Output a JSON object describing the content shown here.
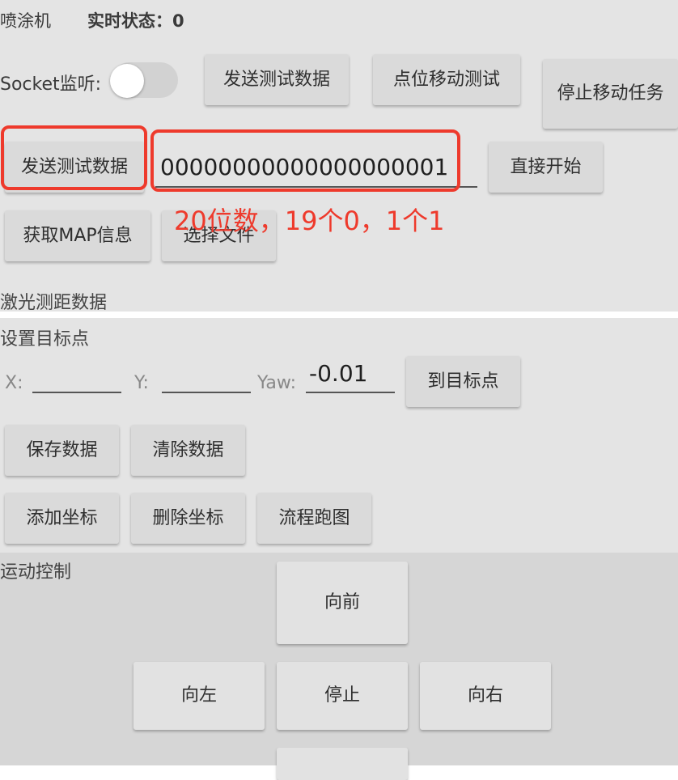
{
  "header": {
    "app_title": "喷涂机",
    "status_text": "实时状态：0"
  },
  "socket": {
    "label": "Socket监听:",
    "toggle_on": false
  },
  "row1": {
    "send_test": "发送测试数据",
    "point_move_test": "点位移动测试",
    "stop_move_task": "停止移动任务"
  },
  "row2": {
    "send_test": "发送测试数据",
    "data_value": "00000000000000000001",
    "direct_start": "直接开始"
  },
  "annotation": {
    "text": "20位数，19个0，1个1",
    "color": "#ee3a2c"
  },
  "row3": {
    "get_map": "获取MAP信息",
    "choose_file": "选择文件"
  },
  "laser_section": "激光测距数据",
  "target": {
    "section_title": "设置目标点",
    "x_label": "X:",
    "x_value": "",
    "y_label": "Y:",
    "y_value": "",
    "yaw_label": "Yaw:",
    "yaw_value": "-0.01",
    "goto_button": "到目标点"
  },
  "data_buttons": {
    "save": "保存数据",
    "clear": "清除数据"
  },
  "coord_buttons": {
    "add": "添加坐标",
    "delete": "删除坐标",
    "flow_run": "流程跑图"
  },
  "motion": {
    "section_title": "运动控制",
    "forward": "向前",
    "left": "向左",
    "stop": "停止",
    "right": "向右"
  }
}
